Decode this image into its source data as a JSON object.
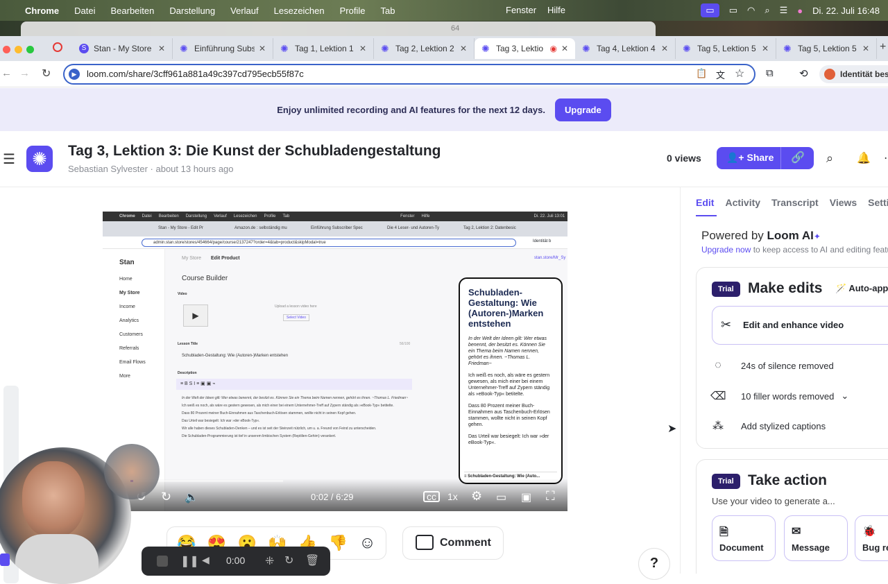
{
  "menubar": {
    "apple": "",
    "app": "Chrome",
    "items": [
      "Datei",
      "Bearbeiten",
      "Darstellung",
      "Verlauf",
      "Lesezeichen",
      "Profile",
      "Tab"
    ],
    "right_items": [
      "Fenster",
      "Hilfe"
    ],
    "datetime": "Di. 22. Juli  16:48"
  },
  "ghost_text": "64",
  "tabs": [
    {
      "label": "Stan - My Store",
      "active": false
    },
    {
      "label": "Einführung Subs",
      "active": false
    },
    {
      "label": "Tag 1, Lektion 1",
      "active": false
    },
    {
      "label": "Tag 2, Lektion 2",
      "active": false
    },
    {
      "label": "Tag 3, Lektio",
      "active": true
    },
    {
      "label": "Tag 4, Lektion 4",
      "active": false
    },
    {
      "label": "Tag 5, Lektion 5",
      "active": false
    },
    {
      "label": "Tag 5, Lektion 5",
      "active": false
    }
  ],
  "address": {
    "url": "loom.com/share/3cff961a881a49c397cd795ecb55f87c",
    "profile": "Identität bes"
  },
  "banner": {
    "text": "Enjoy unlimited recording and AI features for the next 12 days.",
    "button": "Upgrade"
  },
  "header": {
    "title": "Tag 3, Lektion 3: Die Kunst der Schubladengestaltung",
    "author": "Sebastian Sylvester",
    "time": "about 13 hours ago",
    "views": "0 views",
    "share": "Share"
  },
  "video": {
    "menubar": [
      "Chrome",
      "Datei",
      "Bearbeiten",
      "Darstellung",
      "Verlauf",
      "Lesezeichen",
      "Profile",
      "Tab",
      "Fenster",
      "Hilfe"
    ],
    "menubar_time": "Di. 22. Juli  13:01",
    "tabs": [
      "Stan - My Store - Edit Pr",
      "Amazon.de : selbständig mu",
      "Einführung Subscriber Spec",
      "Die 4 Leser- und Autoren-Ty",
      "Tag 2, Lektion 2: Datenbesic"
    ],
    "url": "admin.stan.store/stores/454664/page/course/2137247?order=4&tab=product&skipModal=true",
    "profile": "Identität b",
    "brand": "Stan",
    "sidebar": [
      "Home",
      "My Store",
      "Income",
      "Analytics",
      "Customers",
      "Referrals",
      "Email Flows",
      "More"
    ],
    "breadcrumb_a": "My Store",
    "breadcrumb_b": "Edit Product",
    "store_link": "stan.store/Mr_Sy",
    "course_builder": "Course Builder",
    "video_label": "Video",
    "upload_text": "Upload a lesson video here",
    "select_video": "Select Video",
    "lesson_title_label": "Lesson Title",
    "char_count": "56/100",
    "lesson_title": "Schubladen-Gestaltung:  Wie (Autoren-)Marken entstehen",
    "description_label": "Description",
    "desc_lines": [
      "In der Welt der Ideen gilt: Wer etwas benennt, der besitzt es. Können Sie ein Thema beim Namen nennen, gehört es ihnen. ~Thomas L. Friedman~",
      "Ich weiß es noch, als wäre es gestern gewesen, als mich einer bei einem Unternehmer-Treff auf Zypern ständig als »eBook-Typ« betitelte.",
      "Dass 80 Prozent meiner Buch-Einnahmen aus Taschenbuch-Erlösen stammen, wollte nicht in seinen Kopf gehen.",
      "Das Urteil war besiegelt: Ich war »der eBook-Typ«.",
      "Wir alle haben dieses Schubladen-Denken – und es ist seit der Steinzeit nützlich, um u. a. Freund von Feind zu unterscheiden.",
      "Die Schubladen-Programmierung ist tief in unserem limbischen System (Reptilien-Gehirn) verankert."
    ],
    "card_title": "Schubladen-Gestaltung: Wie (Autoren-)Marken entstehen",
    "card_p1": "In der Welt der Ideen gilt: Wer etwas benennt, der besitzt es. Können Sie ein Thema beim Namen nennen, gehört es ihnen. ~Thomas L. Friedman~",
    "card_p2": "Ich weiß es noch, als wäre es gestern gewesen, als mich einer bei einem Unternehmer-Treff auf Zypern ständig als »eBook-Typ« betitelte.",
    "card_p3": "Dass 80 Prozent meiner Buch-Einnahmen aus Taschenbuch-Erlösen stammen, wollte nicht in seinen Kopf gehen.",
    "card_p4": "Das Urteil war besiegelt: Ich war »der eBook-Typ«.",
    "card_footer": "Schubladen-Gestaltung: Wie (Auto...",
    "time": "0:02 / 6:29",
    "speed": "1x",
    "progress_fraction": 0.005
  },
  "reactions": [
    "😂",
    "😍",
    "😮",
    "🙌",
    "👍",
    "👎"
  ],
  "comment": "Comment",
  "recorder": {
    "time": "0:00"
  },
  "help": "?",
  "panel": {
    "tabs": [
      "Edit",
      "Activity",
      "Transcript",
      "Views",
      "Settings"
    ],
    "powered_prefix": "Powered by ",
    "powered_brand": "Loom AI",
    "upgrade_link": "Upgrade now",
    "upgrade_rest": " to keep access to AI and editing feature",
    "trial": "Trial",
    "make_edits": "Make edits",
    "auto_apply": "Auto-appl",
    "edit_enhance": "Edit and enhance video",
    "silence": "24s of silence removed",
    "filler": "10 filler words removed",
    "captions": "Add stylized captions",
    "take_action": "Take action",
    "take_action_sub": "Use your video to generate a...",
    "actions": [
      "Document",
      "Message",
      "Bug re"
    ]
  }
}
